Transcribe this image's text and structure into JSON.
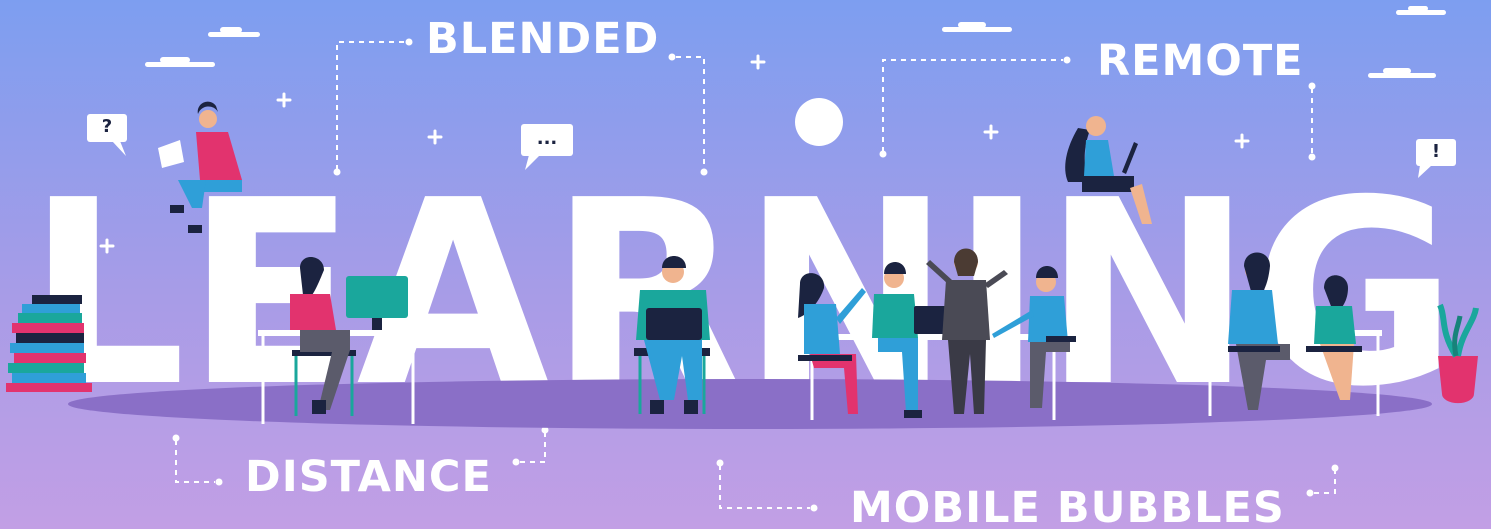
{
  "banner": {
    "big_word": "LEARNING",
    "labels": {
      "blended": "BLENDED",
      "remote": "REMOTE",
      "distance": "DISTANCE",
      "mobile": "MOBILE BUBBLES"
    },
    "bubbles": {
      "question": "?",
      "ellipsis": "...",
      "exclamation": "!"
    }
  },
  "colors": {
    "sky_top": "#7d9ef0",
    "sky_bottom": "#c29fe5",
    "floor": "#8a6fc7",
    "accent_pink": "#e2336e",
    "accent_teal": "#1aa79c",
    "accent_blue": "#2f9fd8",
    "dark_navy": "#1b2340"
  }
}
